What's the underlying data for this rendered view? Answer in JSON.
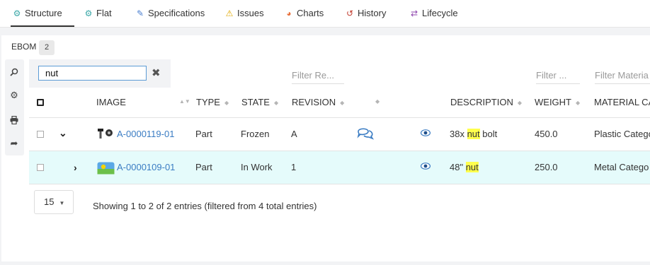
{
  "tabs": [
    {
      "label": "Structure",
      "icon": "structure-icon",
      "glyph": "⚙",
      "color": "#3aa7a7"
    },
    {
      "label": "Flat",
      "icon": "flat-icon",
      "glyph": "⚙",
      "color": "#3aa7a7"
    },
    {
      "label": "Specifications",
      "icon": "specifications-icon",
      "glyph": "✎",
      "color": "#4a7fd0"
    },
    {
      "label": "Issues",
      "icon": "warning-icon",
      "glyph": "⚠",
      "color": "#e0a800"
    },
    {
      "label": "Charts",
      "icon": "pie-chart-icon",
      "glyph": "◕",
      "color": "#e8713c"
    },
    {
      "label": "History",
      "icon": "history-icon",
      "glyph": "↺",
      "color": "#c0392b"
    },
    {
      "label": "Lifecycle",
      "icon": "lifecycle-icon",
      "glyph": "⇄",
      "color": "#8e44ad"
    }
  ],
  "active_tab": "Structure",
  "bom": {
    "label": "EBOM",
    "count": "2"
  },
  "toolbar": {
    "search_icon": "search-icon",
    "settings_icon": "gear-icon",
    "print_icon": "print-icon",
    "share_icon": "share-icon"
  },
  "search": {
    "value": "nut"
  },
  "filters": {
    "revision": "Filter Re...",
    "weight": "Filter ...",
    "material": "Filter Materia"
  },
  "columns": {
    "image": "IMAGE",
    "type": "TYPE",
    "state": "STATE",
    "revision": "REVISION",
    "description": "DESCRIPTION",
    "weight": "WEIGHT",
    "material": "MATERIAL CA"
  },
  "rows": [
    {
      "number": "A-0000119-01",
      "type": "Part",
      "state": "Frozen",
      "revision": "A",
      "desc_pre": "38x ",
      "desc_hl": "nut",
      "desc_post": " bolt",
      "weight": "450.0",
      "material": "Plastic Catego",
      "expanded": true,
      "has_comment": true,
      "selected": false
    },
    {
      "number": "A-0000109-01",
      "type": "Part",
      "state": "In Work",
      "revision": "1",
      "desc_pre": "48\" ",
      "desc_hl": "nut",
      "desc_post": "",
      "weight": "250.0",
      "material": "Metal Catego",
      "expanded": false,
      "has_comment": false,
      "selected": true
    }
  ],
  "pagination": {
    "page_size": "15"
  },
  "info_text": "Showing 1 to 2 of 2 entries (filtered from 4 total entries)",
  "colors": {
    "link": "#3a7cc3",
    "highlight": "#ffff4d",
    "selected_row": "#e5fbfb"
  }
}
